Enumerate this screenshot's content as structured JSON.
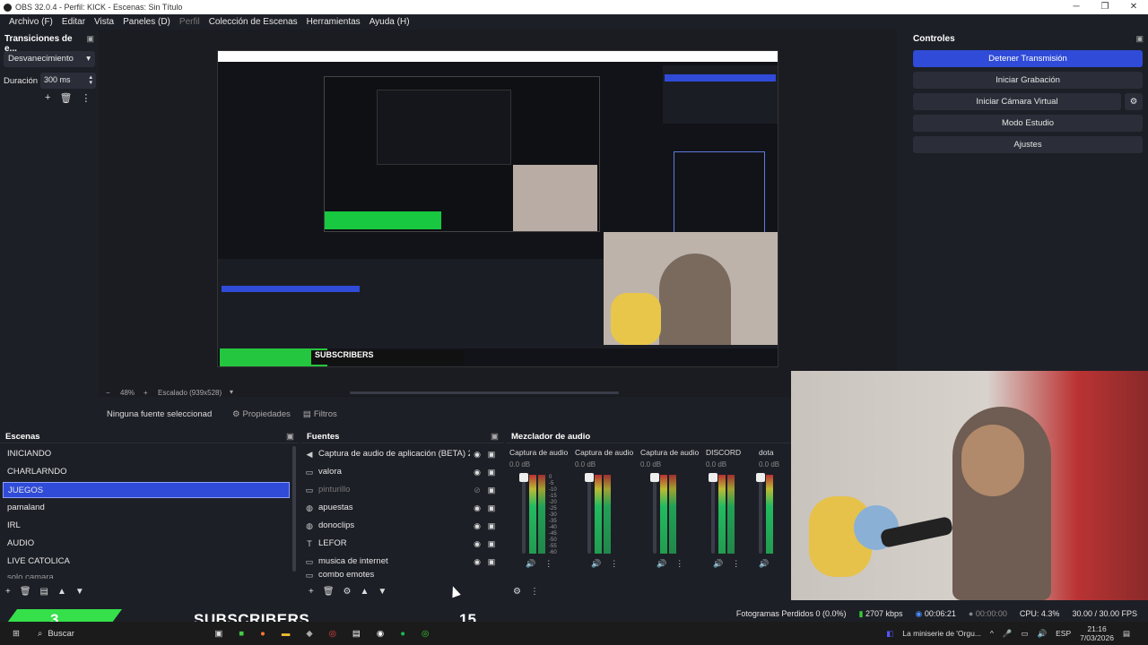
{
  "window": {
    "title": "OBS 32.0.4 - Perfil: KICK - Escenas: Sin Título",
    "minimize": "─",
    "maximize": "❐",
    "close": "✕"
  },
  "menu": [
    "Archivo (F)",
    "Editar",
    "Vista",
    "Paneles (D)",
    "Perfil",
    "Colección de Escenas",
    "Herramientas",
    "Ayuda (H)"
  ],
  "transitions": {
    "title": "Transiciones de e...",
    "selected": "Desvanecimiento",
    "duration_label": "Duración",
    "duration_value": "300 ms"
  },
  "preview": {
    "zoom": "48%",
    "scale_label": "Escalado (939x528)"
  },
  "controls": {
    "title": "Controles",
    "buttons": [
      "Detener Transmisión",
      "Iniciar Grabación",
      "Iniciar Cámara Virtual",
      "Modo Estudio",
      "Ajustes"
    ]
  },
  "propbar": {
    "no_source": "Ninguna fuente seleccionad",
    "properties": "Propiedades",
    "filters": "Filtros"
  },
  "scenes": {
    "title": "Escenas",
    "items": [
      "INICIANDO",
      "CHARLARNDO",
      "JUEGOS",
      "pamaland",
      "IRL",
      "AUDIO",
      "LIVE CATOLICA",
      "solo camara"
    ],
    "selected_index": 2
  },
  "sources": {
    "title": "Fuentes",
    "items": [
      {
        "name": "Captura de audio de aplicación (BETA) 2",
        "icon": "speaker-icon",
        "hidden": false
      },
      {
        "name": "valora",
        "icon": "window-icon",
        "hidden": false
      },
      {
        "name": "pinturillo",
        "icon": "window-icon",
        "hidden": true
      },
      {
        "name": "apuestas",
        "icon": "globe-icon",
        "hidden": false
      },
      {
        "name": "donoclips",
        "icon": "globe-icon",
        "hidden": false
      },
      {
        "name": "LEFOR",
        "icon": "text-icon",
        "hidden": false
      },
      {
        "name": "musica de internet",
        "icon": "window-icon",
        "hidden": false
      },
      {
        "name": "combo emotes",
        "icon": "window-icon",
        "hidden": false
      }
    ]
  },
  "mixer": {
    "title": "Mezclador de audio",
    "channels": [
      {
        "name": "Captura de audio c",
        "db": "0.0 dB"
      },
      {
        "name": "Captura de audio c",
        "db": "0.0 dB"
      },
      {
        "name": "Captura de audio c",
        "db": "0.0 dB"
      },
      {
        "name": "DISCORD",
        "db": "0.0 dB"
      },
      {
        "name": "dota",
        "db": "0.0 dB"
      }
    ],
    "scale": [
      "0",
      "-5",
      "-10",
      "-15",
      "-20",
      "-25",
      "-30",
      "-35",
      "-40",
      "-45",
      "-50",
      "-55",
      "-60"
    ]
  },
  "stats": {
    "dropped": "Fotogramas Perdidos 0 (0.0%)",
    "bitrate": "2707 kbps",
    "stream_time": "00:06:21",
    "rec_time": "00:00:00",
    "cpu": "CPU: 4.3%",
    "fps": "30.00 / 30.00 FPS"
  },
  "overlay": {
    "subs_count": "3",
    "subs_label": "SUBSCRIBERS",
    "subs_goal": "15"
  },
  "taskbar": {
    "search": "Buscar",
    "media": "La miniserie de 'Orgu...",
    "lang": "ESP",
    "time": "21:16",
    "date": "7/03/2026"
  },
  "colors": {
    "accent": "#2f4bd8",
    "panel": "#1d1f26",
    "green_overlay": "#35e04a"
  }
}
